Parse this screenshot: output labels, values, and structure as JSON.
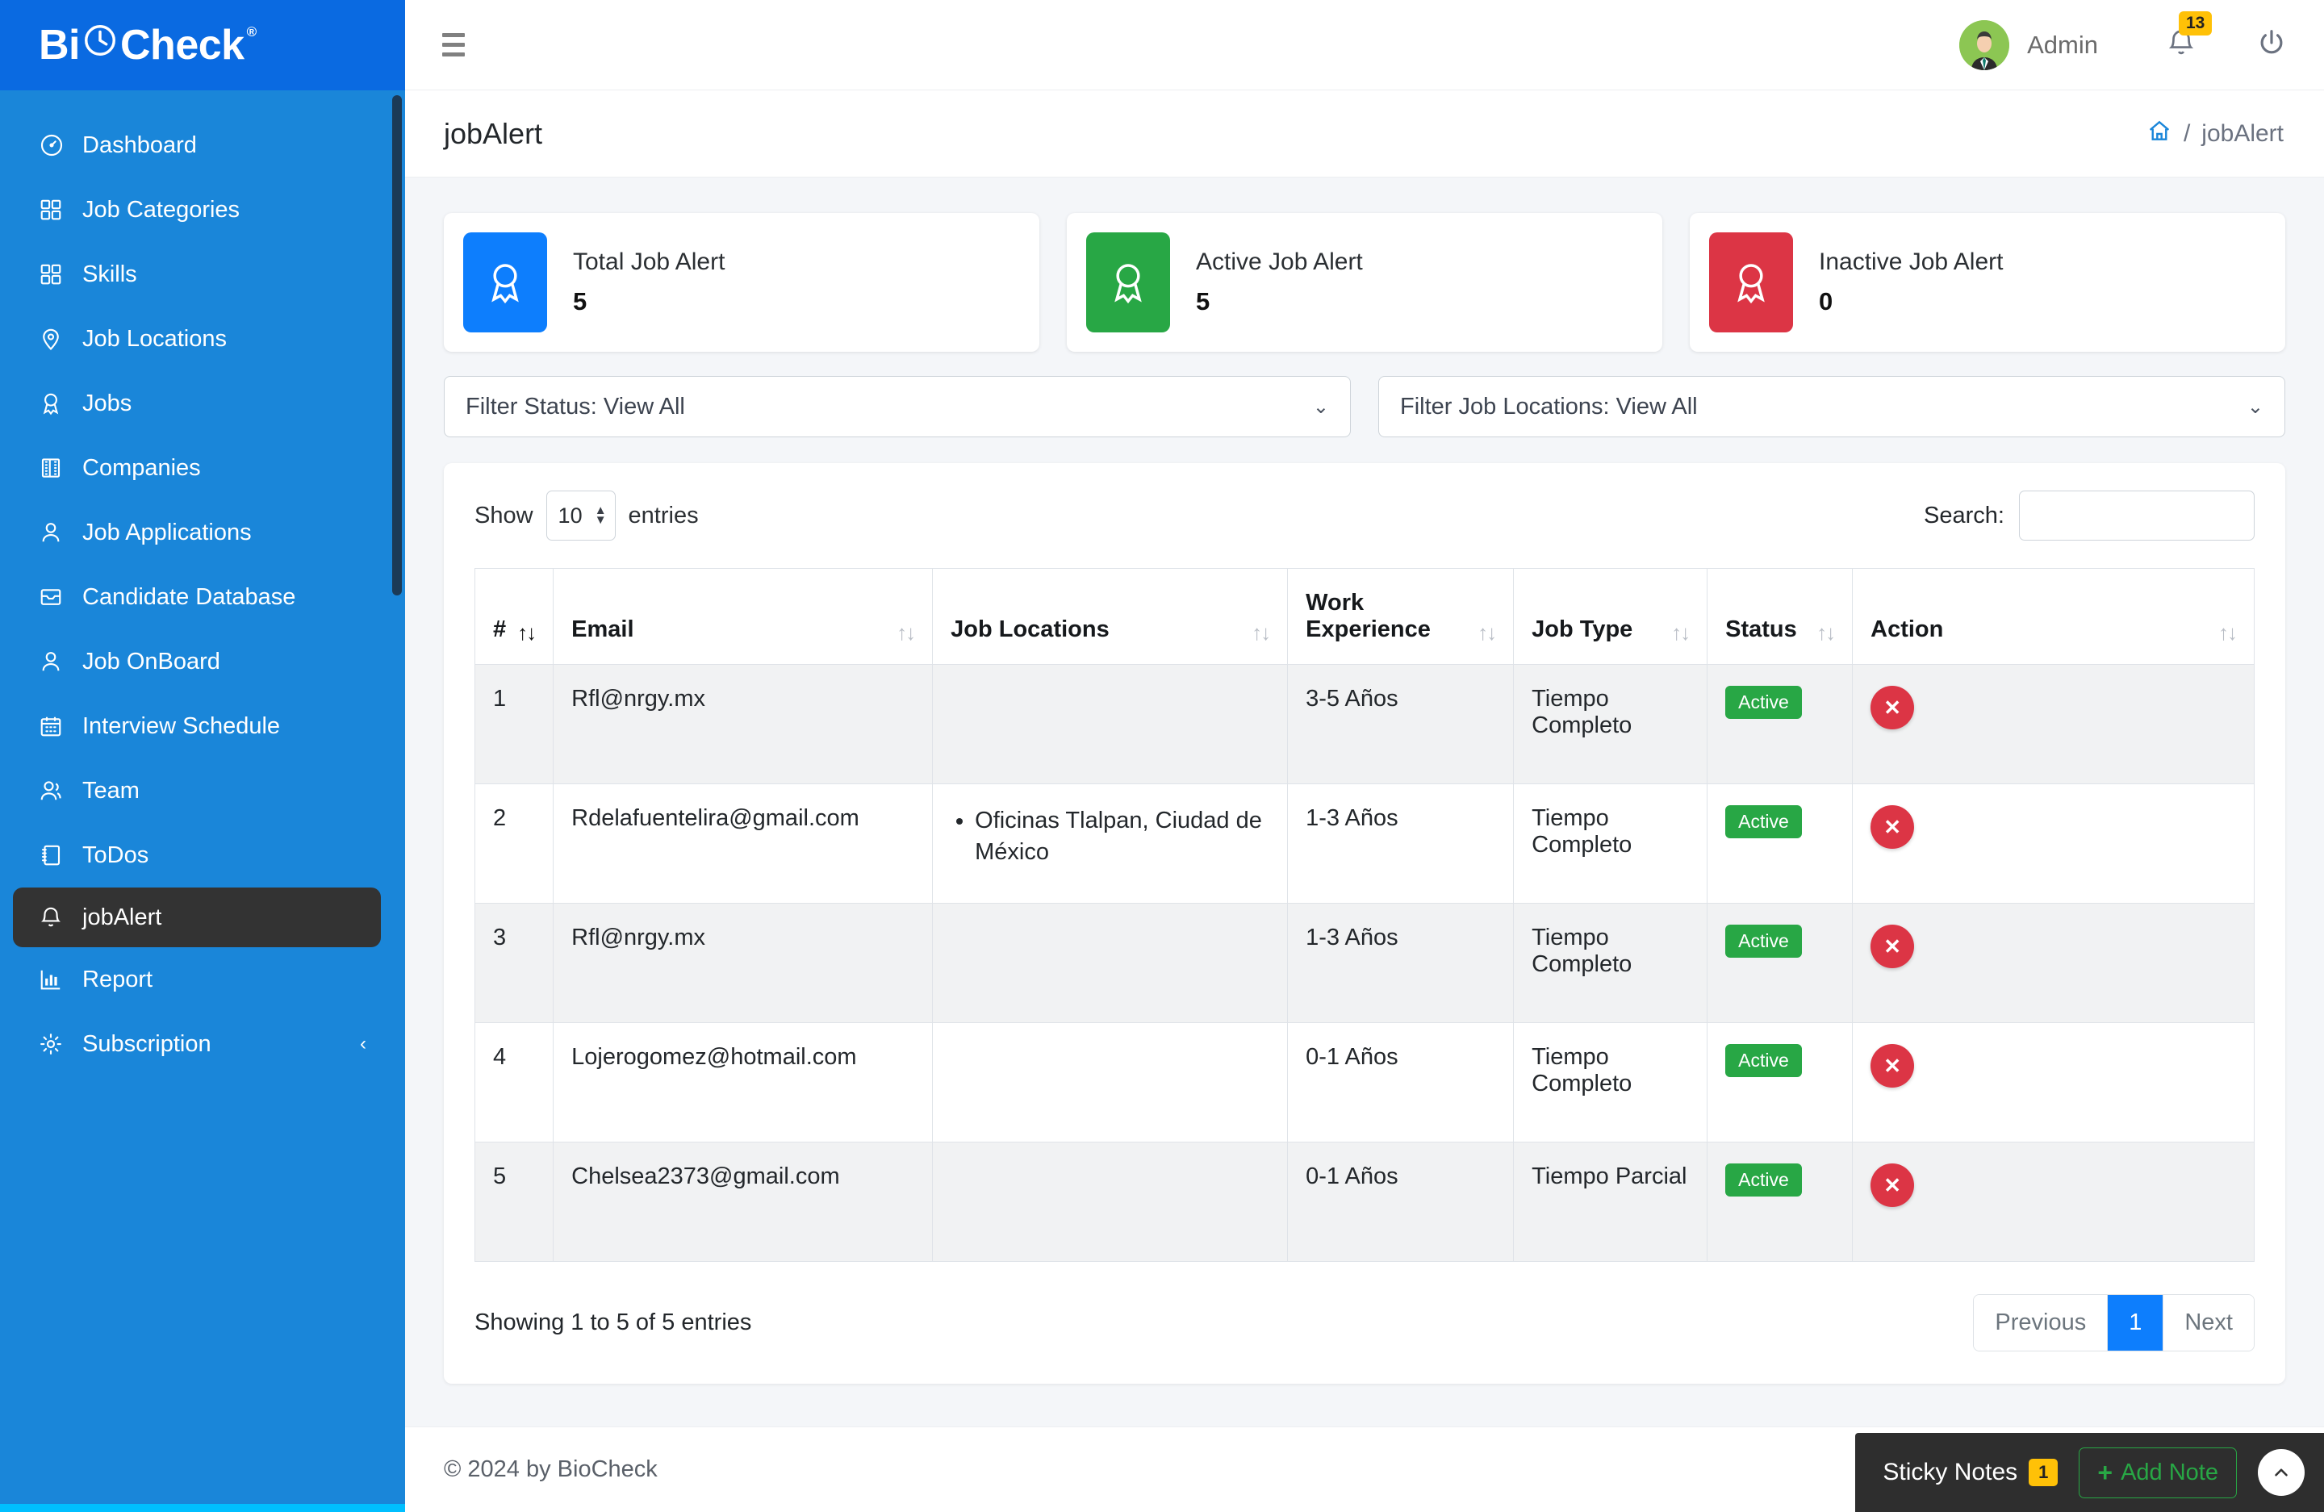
{
  "brand": {
    "name_part1": "Bi",
    "name_part2": "Check",
    "registered": "®"
  },
  "sidebar": {
    "items": [
      {
        "label": "Dashboard",
        "icon": "speedometer-icon"
      },
      {
        "label": "Job Categories",
        "icon": "grid-icon"
      },
      {
        "label": "Skills",
        "icon": "grid-icon"
      },
      {
        "label": "Job Locations",
        "icon": "map-pin-icon"
      },
      {
        "label": "Jobs",
        "icon": "award-icon"
      },
      {
        "label": "Companies",
        "icon": "building-icon"
      },
      {
        "label": "Job Applications",
        "icon": "user-icon"
      },
      {
        "label": "Candidate Database",
        "icon": "inbox-icon"
      },
      {
        "label": "Job OnBoard",
        "icon": "user-icon"
      },
      {
        "label": "Interview Schedule",
        "icon": "calendar-icon"
      },
      {
        "label": "Team",
        "icon": "users-icon"
      },
      {
        "label": "ToDos",
        "icon": "notebook-icon"
      },
      {
        "label": "jobAlert",
        "icon": "bell-icon",
        "active": true
      },
      {
        "label": "Report",
        "icon": "bar-chart-icon"
      },
      {
        "label": "Subscription",
        "icon": "gear-icon",
        "has_chevron": true
      }
    ]
  },
  "topbar": {
    "menu_icon": "hamburger-icon",
    "user_name": "Admin",
    "notification_count": "13",
    "power_icon": "power-icon"
  },
  "page": {
    "title": "jobAlert",
    "breadcrumb_home_icon": "home-icon",
    "breadcrumb_separator": "/",
    "breadcrumb_current": "jobAlert"
  },
  "cards": [
    {
      "label": "Total Job Alert",
      "value": "5",
      "color": "#0d7efd",
      "icon": "award-icon"
    },
    {
      "label": "Active Job Alert",
      "value": "5",
      "color": "#28a745",
      "icon": "award-icon"
    },
    {
      "label": "Inactive Job Alert",
      "value": "0",
      "color": "#dc3545",
      "icon": "award-icon"
    }
  ],
  "filters": [
    {
      "label": "Filter Status: View All"
    },
    {
      "label": "Filter Job Locations: View All"
    }
  ],
  "table_controls": {
    "show_label": "Show",
    "entries_label": "entries",
    "page_size": "10",
    "search_label": "Search:",
    "search_value": "",
    "search_placeholder": ""
  },
  "table": {
    "columns": [
      {
        "label": "#",
        "sortable": true,
        "sort_active": true
      },
      {
        "label": "Email",
        "sortable": true
      },
      {
        "label": "Job Locations",
        "sortable": true
      },
      {
        "label": "Work Experience",
        "sortable": true
      },
      {
        "label": "Job Type",
        "sortable": true
      },
      {
        "label": "Status",
        "sortable": true
      },
      {
        "label": "Action",
        "sortable": true
      }
    ],
    "rows": [
      {
        "num": "1",
        "email": "Rfl@nrgy.mx",
        "locations": [],
        "experience": "3-5 Años",
        "job_type": "Tiempo Completo",
        "status": "Active",
        "action": "delete"
      },
      {
        "num": "2",
        "email": "Rdelafuentelira@gmail.com",
        "locations": [
          "Oficinas Tlalpan, Ciudad de México"
        ],
        "experience": "1-3 Años",
        "job_type": "Tiempo Completo",
        "status": "Active",
        "action": "delete"
      },
      {
        "num": "3",
        "email": "Rfl@nrgy.mx",
        "locations": [],
        "experience": "1-3 Años",
        "job_type": "Tiempo Completo",
        "status": "Active",
        "action": "delete"
      },
      {
        "num": "4",
        "email": "Lojerogomez@hotmail.com",
        "locations": [],
        "experience": "0-1 Años",
        "job_type": "Tiempo Completo",
        "status": "Active",
        "action": "delete"
      },
      {
        "num": "5",
        "email": "Chelsea2373@gmail.com",
        "locations": [],
        "experience": "0-1 Años",
        "job_type": "Tiempo Parcial",
        "status": "Active",
        "action": "delete"
      }
    ]
  },
  "pagination": {
    "showing": "Showing 1 to 5 of 5 entries",
    "previous": "Previous",
    "current_page": "1",
    "next": "Next"
  },
  "footer": {
    "copyright": "© 2024 by BioCheck"
  },
  "sticky_notes": {
    "label": "Sticky Notes",
    "count": "1",
    "add_label": "Add Note",
    "plus": "+",
    "collapse_icon": "chevron-up-icon"
  }
}
